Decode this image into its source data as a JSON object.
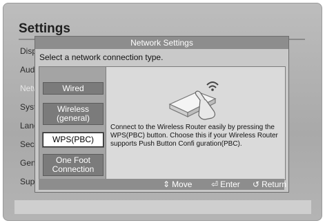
{
  "background": {
    "title": "Settings",
    "menu": [
      "Displ",
      "Audi",
      "Netw",
      "Syst",
      "Lang",
      "Secu",
      "Gene",
      "Supp"
    ]
  },
  "dialog": {
    "title": "Network Settings",
    "prompt": "Select a network connection type.",
    "options": [
      {
        "label": "Wired",
        "selected": false
      },
      {
        "label": "Wireless (general)",
        "selected": false
      },
      {
        "label": "WPS(PBC)",
        "selected": true
      },
      {
        "label": "One Foot Connection",
        "selected": false
      }
    ],
    "description": "Connect to the Wireless Router easily by pressing the WPS(PBC) button. Choose this if your Wireless Router supports Push Button Confi guration(PBC).",
    "hints": {
      "move_icon": "updown-arrow-icon",
      "move": "Move",
      "enter_icon": "enter-icon",
      "enter": "Enter",
      "return_icon": "return-icon",
      "return": "Return"
    }
  }
}
